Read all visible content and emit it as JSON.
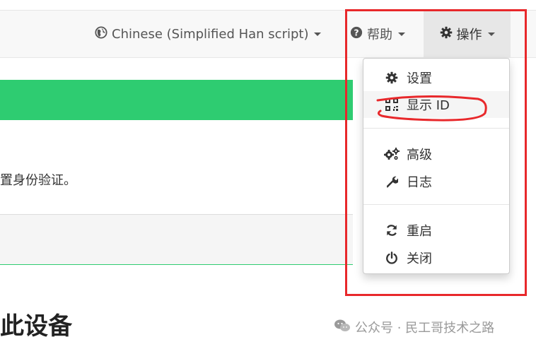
{
  "navbar": {
    "language": {
      "label": "Chinese (Simplified Han script)",
      "icon": "globe-icon"
    },
    "help": {
      "label": "帮助",
      "icon": "question-circle-icon"
    },
    "actions": {
      "label": "操作",
      "icon": "gear-icon"
    }
  },
  "content": {
    "text": "置身份验证。",
    "heading": "此设备",
    "status_color": "#2ecc71"
  },
  "dropdown": {
    "items": [
      {
        "label": "设置",
        "icon": "gear-icon"
      },
      {
        "label": "显示 ID",
        "icon": "qrcode-icon"
      },
      {
        "label": "高级",
        "icon": "cogs-icon"
      },
      {
        "label": "日志",
        "icon": "wrench-icon"
      },
      {
        "label": "重启",
        "icon": "refresh-icon"
      },
      {
        "label": "关闭",
        "icon": "power-icon"
      }
    ]
  },
  "watermark": {
    "text": "公众号 · 民工哥技术之路",
    "icon": "wechat-icon"
  },
  "annotation": {
    "color": "#e8282b"
  }
}
